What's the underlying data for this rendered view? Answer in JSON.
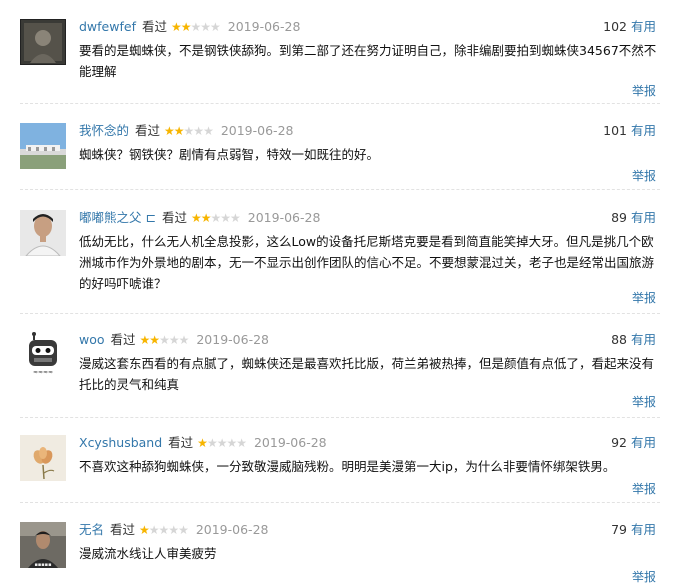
{
  "watched_label": "看过",
  "useful_label": "有用",
  "report_label": "举报",
  "star_colors": {
    "on": "#f7b500",
    "off": "#d6d6d6"
  },
  "reviews": [
    {
      "username": "dwfewfef",
      "rating": 2,
      "date": "2019-06-28",
      "votes": "102",
      "avatar": "dark-portrait-avatar",
      "content": "要看的是蜘蛛侠，不是钢铁侠舔狗。到第二部了还在努力证明自己，除非编剧要拍到蜘蛛侠34567不然不能理解"
    },
    {
      "username": "我怀念的",
      "rating": 2,
      "date": "2019-06-28",
      "votes": "101",
      "avatar": "landscape-sky-avatar",
      "content": "蜘蛛侠？钢铁侠？剧情有点弱智，特效一如既往的好。"
    },
    {
      "username": "嘟嘟熊之父 ⊏",
      "rating": 2,
      "date": "2019-06-28",
      "votes": "89",
      "avatar": "man-portrait-avatar",
      "content": "低幼无比，什么无人机全息投影，这么Low的设备托尼斯塔克要是看到简直能笑掉大牙。但凡是挑几个欧洲城市作为外景地的剧本，无一不显示出创作团队的信心不足。不要想蒙混过关，老子也是经常出国旅游的好吗吓唬谁？"
    },
    {
      "username": "woo",
      "rating": 2,
      "date": "2019-06-28",
      "votes": "88",
      "avatar": "robot-logo-avatar",
      "content": "漫威这套东西看的有点腻了，蜘蛛侠还是最喜欢托比版，荷兰弟被热捧，但是颜值有点低了，看起来没有托比的灵气和纯真"
    },
    {
      "username": "Xcyshusband",
      "rating": 1,
      "date": "2019-06-28",
      "votes": "92",
      "avatar": "flower-avatar",
      "content": "不喜欢这种舔狗蜘蛛侠，一分致敬漫威脑残粉。明明是美漫第一大ip，为什么非要情怀绑架铁男。"
    },
    {
      "username": "无名",
      "rating": 1,
      "date": "2019-06-28",
      "votes": "79",
      "avatar": "person-photo-avatar",
      "content": "漫威流水线让人审美疲劳"
    }
  ]
}
